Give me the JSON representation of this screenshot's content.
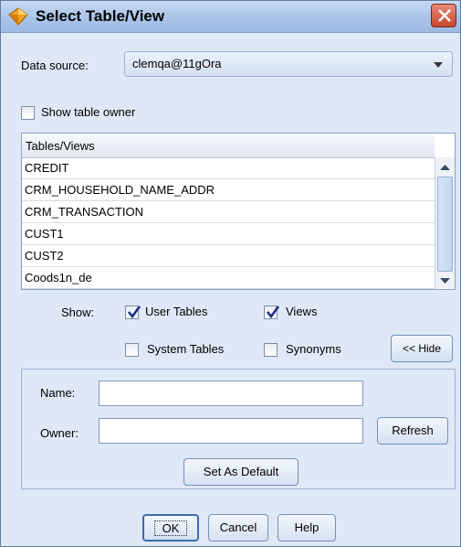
{
  "window": {
    "title": "Select Table/View"
  },
  "data_source": {
    "label": "Data source:",
    "value": "clemqa@11gOra"
  },
  "show_table_owner": {
    "label": "Show table owner",
    "checked": false
  },
  "tables": {
    "header": "Tables/Views",
    "rows": [
      "CREDIT",
      "CRM_HOUSEHOLD_NAME_ADDR",
      "CRM_TRANSACTION",
      "CUST1",
      "CUST2",
      "Coods1n_de"
    ]
  },
  "show": {
    "label": "Show:",
    "user_tables": {
      "label": "User Tables",
      "checked": true
    },
    "views": {
      "label": "Views",
      "checked": true
    },
    "system_tables": {
      "label": "System Tables",
      "checked": false
    },
    "synonyms": {
      "label": "Synonyms",
      "checked": false
    },
    "hide_button": "<< Hide"
  },
  "filter": {
    "name_label": "Name:",
    "name_value": "",
    "owner_label": "Owner:",
    "owner_value": "",
    "refresh_button": "Refresh",
    "set_default_button": "Set As Default"
  },
  "buttons": {
    "ok": "OK",
    "cancel": "Cancel",
    "help": "Help"
  }
}
